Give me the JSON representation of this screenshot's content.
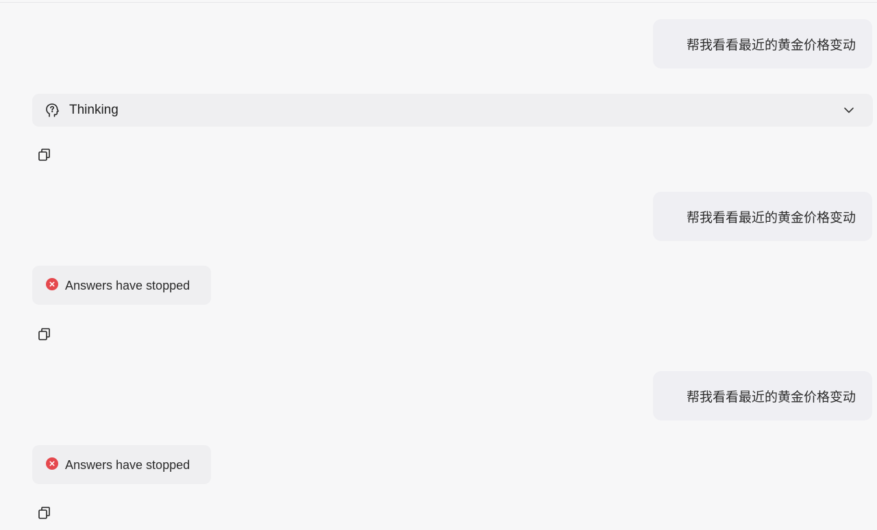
{
  "messages": [
    {
      "role": "user",
      "text": "帮我看看最近的黄金价格变动"
    },
    {
      "role": "assistant",
      "status_label": "Thinking",
      "status_icon": "brain-icon",
      "expand_icon": "chevron-down-icon",
      "action_icon": "copy-icon"
    },
    {
      "role": "user",
      "text": "帮我看看最近的黄金价格变动"
    },
    {
      "role": "assistant",
      "status_label": "Answers have stopped",
      "status_icon": "error-circle-icon",
      "action_icon": "copy-icon"
    },
    {
      "role": "user",
      "text": "帮我看看最近的黄金价格变动"
    },
    {
      "role": "assistant",
      "status_label": "Answers have stopped",
      "status_icon": "error-circle-icon",
      "action_icon": "copy-icon"
    }
  ],
  "colors": {
    "error": "#e5484d",
    "bubble_bg": "#efeff3",
    "page_bg": "#f7f7f8"
  }
}
